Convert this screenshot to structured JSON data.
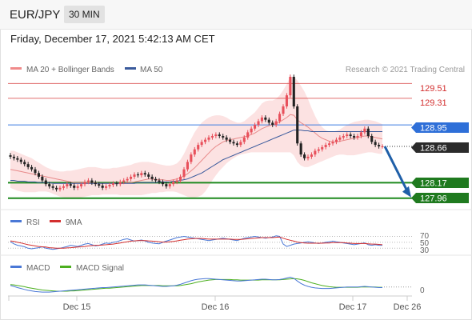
{
  "header": {
    "symbol": "EUR/JPY",
    "timeframe": "30 MIN"
  },
  "datetime": "Friday, December 17, 2021 5:42:13 AM CET",
  "legend": {
    "ma20": "MA 20 + Bollinger Bands",
    "ma50": "MA 50",
    "credit": "Research © 2021 Trading Central"
  },
  "rsi_legend": {
    "rsi": "RSI",
    "ma": "9MA"
  },
  "macd_legend": {
    "macd": "MACD",
    "signal": "MACD Signal"
  },
  "colors": {
    "up": "#e8505b",
    "down": "#222222",
    "bands": "#fbd6d6",
    "ma20": "#e88a8a",
    "ma50": "#3a5a9c",
    "resistance": "#d32f2f",
    "current": "#3b7be0",
    "support": "#1f8a1f",
    "arrow": "#1f5fa8"
  },
  "chart_data": [
    {
      "type": "candlestick",
      "title": "EUR/JPY 30 MIN",
      "x_labels": [
        "Dec 15",
        "Dec 16",
        "Dec 17",
        "Dec 26"
      ],
      "ylim": [
        127.86,
        129.6
      ],
      "levels": {
        "resistance": [
          129.51,
          129.31
        ],
        "current": 128.95,
        "last": 128.66,
        "support": [
          128.17,
          127.96
        ]
      },
      "level_labels": [
        "129.51",
        "129.31",
        "128.95",
        "128.66",
        "128.17",
        "127.96"
      ],
      "close": [
        128.52,
        128.5,
        128.48,
        128.45,
        128.42,
        128.38,
        128.35,
        128.3,
        128.25,
        128.2,
        128.15,
        128.12,
        128.1,
        128.08,
        128.1,
        128.12,
        128.15,
        128.13,
        128.1,
        128.12,
        128.15,
        128.18,
        128.2,
        128.17,
        128.15,
        128.13,
        128.1,
        128.12,
        128.14,
        128.16,
        128.15,
        128.18,
        128.2,
        128.22,
        128.25,
        128.28,
        128.27,
        128.3,
        128.28,
        128.25,
        128.22,
        128.2,
        128.18,
        128.15,
        128.12,
        128.15,
        128.18,
        128.2,
        128.25,
        128.35,
        128.45,
        128.55,
        128.62,
        128.68,
        128.72,
        128.75,
        128.78,
        128.8,
        128.82,
        128.8,
        128.78,
        128.75,
        128.72,
        128.7,
        128.68,
        128.72,
        128.78,
        128.85,
        128.9,
        128.95,
        129.0,
        129.05,
        129.02,
        128.98,
        128.95,
        129.0,
        129.1,
        129.2,
        129.35,
        129.6,
        129.2,
        128.7,
        128.55,
        128.5,
        128.52,
        128.55,
        128.6,
        128.62,
        128.65,
        128.68,
        128.7,
        128.72,
        128.75,
        128.78,
        128.8,
        128.82,
        128.8,
        128.78,
        128.8,
        128.85,
        128.9,
        128.8,
        128.72,
        128.68,
        128.66,
        128.66
      ],
      "ma20": [
        128.35,
        128.34,
        128.33,
        128.32,
        128.31,
        128.3,
        128.29,
        128.28,
        128.27,
        128.26,
        128.25,
        128.24,
        128.23,
        128.22,
        128.21,
        128.2,
        128.19,
        128.18,
        128.17,
        128.17,
        128.17,
        128.17,
        128.17,
        128.17,
        128.17,
        128.16,
        128.16,
        128.16,
        128.16,
        128.16,
        128.16,
        128.16,
        128.16,
        128.17,
        128.17,
        128.18,
        128.19,
        128.2,
        128.21,
        128.22,
        128.22,
        128.21,
        128.21,
        128.21,
        128.2,
        128.2,
        128.21,
        128.22,
        128.24,
        128.26,
        128.29,
        128.33,
        128.37,
        128.42,
        128.47,
        128.52,
        128.57,
        128.62,
        128.66,
        128.69,
        128.72,
        128.74,
        128.75,
        128.76,
        128.77,
        128.78,
        128.79,
        128.8,
        128.82,
        128.84,
        128.87,
        128.9,
        128.92,
        128.94,
        128.95,
        128.97,
        128.99,
        129.02,
        129.05,
        129.09,
        129.08,
        129.02,
        128.98,
        128.95,
        128.92,
        128.88,
        128.84,
        128.8,
        128.77,
        128.75,
        128.73,
        128.72,
        128.72,
        128.73,
        128.74,
        128.75,
        128.76,
        128.77,
        128.78,
        128.79,
        128.8,
        128.8,
        128.79,
        128.78,
        128.77,
        128.76
      ],
      "ma50": [
        128.2,
        128.2,
        128.19,
        128.19,
        128.19,
        128.18,
        128.18,
        128.18,
        128.17,
        128.17,
        128.17,
        128.17,
        128.16,
        128.16,
        128.16,
        128.16,
        128.16,
        128.16,
        128.16,
        128.16,
        128.16,
        128.16,
        128.16,
        128.16,
        128.16,
        128.16,
        128.16,
        128.16,
        128.16,
        128.16,
        128.16,
        128.16,
        128.16,
        128.16,
        128.16,
        128.16,
        128.17,
        128.17,
        128.17,
        128.17,
        128.17,
        128.17,
        128.18,
        128.18,
        128.18,
        128.18,
        128.19,
        128.19,
        128.2,
        128.21,
        128.22,
        128.24,
        128.26,
        128.28,
        128.3,
        128.33,
        128.36,
        128.39,
        128.42,
        128.45,
        128.48,
        128.5,
        128.52,
        128.54,
        128.56,
        128.58,
        128.6,
        128.62,
        128.64,
        128.66,
        128.68,
        128.7,
        128.72,
        128.74,
        128.76,
        128.78,
        128.8,
        128.82,
        128.84,
        128.86,
        128.88,
        128.88,
        128.88,
        128.87,
        128.87,
        128.86,
        128.86,
        128.86,
        128.86,
        128.86,
        128.86,
        128.86,
        128.86,
        128.86,
        128.86,
        128.86,
        128.86,
        128.86,
        128.86,
        128.86,
        128.86,
        128.86,
        128.86,
        128.86,
        128.86,
        128.86
      ],
      "bb_upper": [
        128.6,
        128.6,
        128.58,
        128.56,
        128.54,
        128.52,
        128.5,
        128.47,
        128.44,
        128.41,
        128.38,
        128.36,
        128.34,
        128.33,
        128.32,
        128.32,
        128.33,
        128.33,
        128.34,
        128.35,
        128.36,
        128.37,
        128.38,
        128.38,
        128.38,
        128.37,
        128.36,
        128.36,
        128.36,
        128.37,
        128.37,
        128.38,
        128.39,
        128.4,
        128.41,
        128.43,
        128.44,
        128.45,
        128.45,
        128.45,
        128.44,
        128.43,
        128.42,
        128.41,
        128.4,
        128.4,
        128.41,
        128.43,
        128.48,
        128.56,
        128.66,
        128.76,
        128.85,
        128.92,
        128.98,
        129.02,
        129.05,
        129.07,
        129.08,
        129.08,
        129.07,
        129.05,
        129.02,
        129.0,
        128.98,
        128.98,
        129.0,
        129.04,
        129.08,
        129.12,
        129.18,
        129.24,
        129.27,
        129.28,
        129.28,
        129.3,
        129.35,
        129.42,
        129.5,
        129.6,
        129.6,
        129.55,
        129.48,
        129.4,
        129.3,
        129.18,
        129.07,
        128.98,
        128.92,
        128.88,
        128.86,
        128.86,
        128.87,
        128.89,
        128.92,
        128.95,
        128.97,
        128.99,
        129.0,
        129.01,
        129.02,
        129.02,
        129.01,
        129.0,
        128.98,
        128.96
      ],
      "bb_lower": [
        128.1,
        128.08,
        128.06,
        128.05,
        128.04,
        128.04,
        128.04,
        128.04,
        128.05,
        128.05,
        128.05,
        128.04,
        128.02,
        128.0,
        127.98,
        127.97,
        127.96,
        127.95,
        127.95,
        127.96,
        127.97,
        127.98,
        127.99,
        128.0,
        128.0,
        128.0,
        128.01,
        128.01,
        128.01,
        128.01,
        128.01,
        128.0,
        128.0,
        128.0,
        128.0,
        128.0,
        128.0,
        128.0,
        128.01,
        128.02,
        128.03,
        128.03,
        128.04,
        128.04,
        128.05,
        128.05,
        128.05,
        128.04,
        128.02,
        128.0,
        127.98,
        127.97,
        127.97,
        127.98,
        128.0,
        128.05,
        128.12,
        128.2,
        128.27,
        128.33,
        128.38,
        128.43,
        128.47,
        128.5,
        128.53,
        128.55,
        128.56,
        128.57,
        128.58,
        128.58,
        128.58,
        128.58,
        128.58,
        128.58,
        128.58,
        128.58,
        128.58,
        128.58,
        128.58,
        128.58,
        128.54,
        128.45,
        128.4,
        128.38,
        128.38,
        128.4,
        128.42,
        128.44,
        128.46,
        128.48,
        128.5,
        128.52,
        128.54,
        128.55,
        128.55,
        128.54,
        128.54,
        128.54,
        128.55,
        128.56,
        128.57,
        128.58,
        128.58,
        128.57,
        128.56,
        128.56
      ]
    },
    {
      "type": "line",
      "title": "RSI",
      "levels": [
        70,
        50,
        30
      ],
      "level_labels": [
        "70",
        "50",
        "30"
      ],
      "ylim": [
        20,
        85
      ],
      "series": [
        {
          "name": "RSI",
          "values": [
            52,
            45,
            40,
            38,
            35,
            30,
            28,
            30,
            32,
            35,
            30,
            28,
            26,
            28,
            30,
            33,
            36,
            40,
            38,
            36,
            40,
            44,
            46,
            42,
            38,
            40,
            44,
            48,
            46,
            50,
            52,
            56,
            60,
            62,
            58,
            54,
            56,
            58,
            55,
            50,
            48,
            46,
            45,
            50,
            54,
            58,
            62,
            66,
            68,
            70,
            68,
            66,
            64,
            62,
            60,
            58,
            56,
            58,
            60,
            62,
            64,
            62,
            60,
            58,
            56,
            60,
            64,
            66,
            68,
            70,
            68,
            66,
            64,
            66,
            68,
            72,
            70,
            44,
            36,
            40,
            44,
            46,
            48,
            50,
            52,
            50,
            48,
            46,
            48,
            50,
            52,
            54,
            52,
            50,
            48,
            46,
            44,
            42,
            44,
            46,
            48,
            42,
            40,
            42,
            40,
            40
          ]
        },
        {
          "name": "9MA",
          "values": [
            55,
            53,
            50,
            48,
            45,
            42,
            40,
            38,
            36,
            35,
            34,
            32,
            31,
            30,
            30,
            30,
            31,
            32,
            33,
            34,
            35,
            36,
            38,
            39,
            40,
            40,
            41,
            42,
            43,
            44,
            46,
            48,
            50,
            52,
            54,
            55,
            56,
            56,
            56,
            55,
            54,
            53,
            52,
            51,
            51,
            52,
            53,
            55,
            57,
            59,
            61,
            62,
            63,
            63,
            63,
            62,
            61,
            61,
            61,
            61,
            61,
            61,
            61,
            60,
            60,
            60,
            61,
            62,
            63,
            64,
            65,
            66,
            66,
            66,
            66,
            67,
            68,
            64,
            60,
            57,
            54,
            51,
            49,
            48,
            47,
            47,
            47,
            47,
            47,
            48,
            48,
            49,
            49,
            49,
            49,
            48,
            47,
            46,
            46,
            46,
            46,
            45,
            44,
            44,
            43,
            42
          ]
        }
      ]
    },
    {
      "type": "line",
      "title": "MACD",
      "level_labels": [
        "0"
      ],
      "ylim": [
        -0.3,
        0.5
      ],
      "series": [
        {
          "name": "MACD",
          "values": [
            0.05,
            0.02,
            -0.02,
            -0.05,
            -0.08,
            -0.11,
            -0.13,
            -0.15,
            -0.16,
            -0.17,
            -0.17,
            -0.17,
            -0.16,
            -0.15,
            -0.14,
            -0.13,
            -0.12,
            -0.11,
            -0.1,
            -0.09,
            -0.08,
            -0.07,
            -0.06,
            -0.05,
            -0.04,
            -0.03,
            -0.02,
            -0.02,
            -0.01,
            0.0,
            0.01,
            0.02,
            0.03,
            0.04,
            0.05,
            0.06,
            0.07,
            0.07,
            0.07,
            0.06,
            0.05,
            0.04,
            0.03,
            0.02,
            0.02,
            0.03,
            0.04,
            0.06,
            0.09,
            0.13,
            0.17,
            0.21,
            0.24,
            0.26,
            0.27,
            0.28,
            0.28,
            0.27,
            0.26,
            0.25,
            0.24,
            0.23,
            0.22,
            0.21,
            0.2,
            0.2,
            0.21,
            0.22,
            0.23,
            0.24,
            0.25,
            0.26,
            0.26,
            0.25,
            0.24,
            0.24,
            0.25,
            0.27,
            0.3,
            0.33,
            0.29,
            0.2,
            0.12,
            0.06,
            0.02,
            -0.01,
            -0.03,
            -0.04,
            -0.05,
            -0.05,
            -0.05,
            -0.04,
            -0.03,
            -0.02,
            -0.01,
            0.0,
            0.0,
            0.0,
            0.0,
            0.01,
            0.02,
            0.01,
            0.0,
            -0.01,
            -0.02,
            -0.02
          ]
        },
        {
          "name": "MACD Signal",
          "values": [
            0.08,
            0.07,
            0.05,
            0.03,
            0.01,
            -0.02,
            -0.04,
            -0.06,
            -0.08,
            -0.1,
            -0.11,
            -0.12,
            -0.13,
            -0.14,
            -0.14,
            -0.14,
            -0.14,
            -0.13,
            -0.13,
            -0.12,
            -0.11,
            -0.1,
            -0.09,
            -0.08,
            -0.07,
            -0.06,
            -0.05,
            -0.04,
            -0.04,
            -0.03,
            -0.02,
            -0.01,
            0.0,
            0.01,
            0.02,
            0.03,
            0.04,
            0.05,
            0.05,
            0.05,
            0.05,
            0.05,
            0.05,
            0.04,
            0.04,
            0.04,
            0.04,
            0.04,
            0.05,
            0.07,
            0.09,
            0.11,
            0.14,
            0.17,
            0.19,
            0.21,
            0.23,
            0.24,
            0.25,
            0.25,
            0.25,
            0.25,
            0.25,
            0.24,
            0.24,
            0.23,
            0.23,
            0.23,
            0.23,
            0.23,
            0.23,
            0.24,
            0.24,
            0.24,
            0.24,
            0.24,
            0.24,
            0.25,
            0.26,
            0.27,
            0.28,
            0.27,
            0.25,
            0.22,
            0.18,
            0.14,
            0.11,
            0.08,
            0.05,
            0.03,
            0.01,
            0.0,
            -0.01,
            -0.01,
            -0.01,
            -0.01,
            -0.01,
            -0.01,
            -0.01,
            0.0,
            0.0,
            0.0,
            0.0,
            0.0,
            -0.01,
            -0.01
          ]
        }
      ]
    }
  ]
}
